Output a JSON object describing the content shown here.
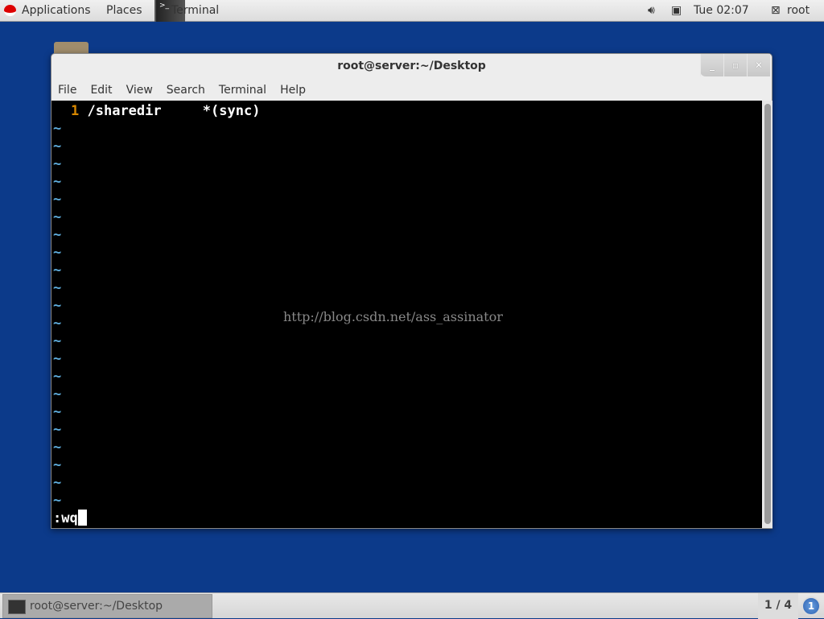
{
  "topbar": {
    "applications": "Applications",
    "places": "Places",
    "active_app": "Terminal",
    "clock": "Tue 02:07",
    "user": "root"
  },
  "window": {
    "title": "root@server:~/Desktop",
    "minimize": "_",
    "maximize": "▫",
    "close": "✕",
    "menu": [
      "File",
      "Edit",
      "View",
      "Search",
      "Terminal",
      "Help"
    ]
  },
  "editor": {
    "line_number": "1",
    "line_text": "/sharedir     *(sync)",
    "tilde": "~",
    "command": ":wq",
    "watermark": "http://blog.csdn.net/ass_assinator"
  },
  "taskbar": {
    "task_label": "root@server:~/Desktop",
    "workspace": "1 / 4",
    "notifications": "1"
  }
}
